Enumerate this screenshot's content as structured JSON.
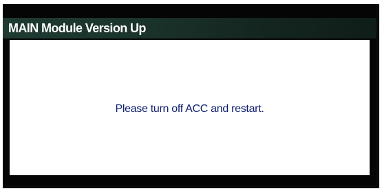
{
  "dialog": {
    "title": "MAIN Module Version Up",
    "message": "Please turn off ACC and restart."
  },
  "colors": {
    "title_bar": "#1e3a31",
    "title_text": "#ffffff",
    "dialog_background": "#ffffff",
    "message_text": "#0c1e6e",
    "screen_background": "#050505"
  }
}
